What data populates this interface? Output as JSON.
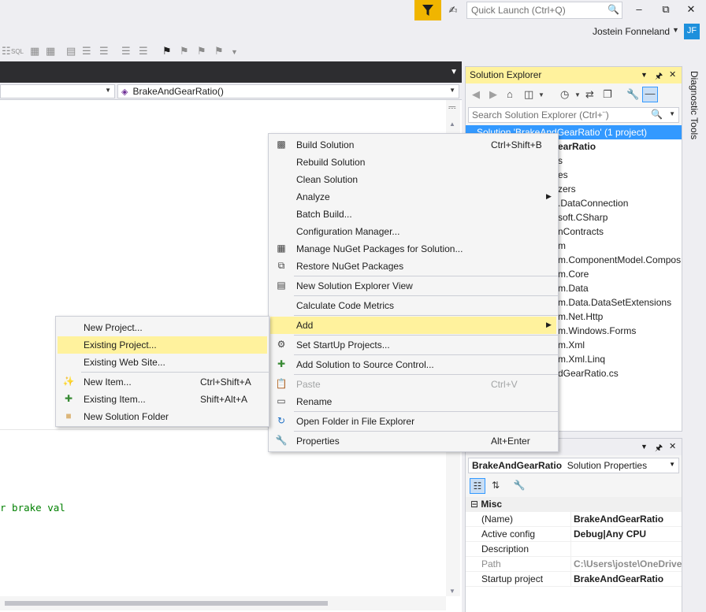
{
  "titlebar": {
    "quick_launch_placeholder": "Quick Launch (Ctrl+Q)",
    "user_name": "Jostein Fonneland",
    "user_initials": "JF",
    "filter_color": "#f0b500"
  },
  "editor": {
    "nav_member": "BrakeAndGearRatio()",
    "code_fragment": "r brake val"
  },
  "solution_explorer": {
    "title": "Solution Explorer",
    "search_placeholder": "Search Solution Explorer (Ctrl+¨)",
    "selected_item": "Solution 'BrakeAndGearRatio' (1 project)",
    "items": [
      "earRatio",
      "s",
      "es",
      "zers",
      ".DataConnection",
      "soft.CSharp",
      "nContracts",
      "m",
      "m.ComponentModel.Compos",
      "m.Core",
      "m.Data",
      "m.Data.DataSetExtensions",
      "m.Net.Http",
      "m.Windows.Forms",
      "m.Xml",
      "m.Xml.Linq",
      "dGearRatio.cs"
    ]
  },
  "diagnostic_tools": {
    "label": "Diagnostic Tools"
  },
  "properties": {
    "object_name": "BrakeAndGearRatio",
    "object_type": "Solution Properties",
    "category": "Misc",
    "rows": [
      {
        "name": "(Name)",
        "value": "BrakeAndGearRatio"
      },
      {
        "name": "Active config",
        "value": "Debug|Any CPU"
      },
      {
        "name": "Description",
        "value": ""
      },
      {
        "name": "Path",
        "value": "C:\\Users\\joste\\OneDrive"
      },
      {
        "name": "Startup project",
        "value": "BrakeAndGearRatio"
      }
    ]
  },
  "context_menu": {
    "items": [
      {
        "label": "Build Solution",
        "shortcut": "Ctrl+Shift+B",
        "icon": "build-icon"
      },
      {
        "label": "Rebuild Solution",
        "shortcut": "",
        "icon": ""
      },
      {
        "label": "Clean Solution",
        "shortcut": "",
        "icon": ""
      },
      {
        "label": "Analyze",
        "shortcut": "",
        "icon": ""
      },
      {
        "label": "Batch Build...",
        "shortcut": "",
        "icon": ""
      },
      {
        "label": "Configuration Manager...",
        "shortcut": "",
        "icon": ""
      },
      {
        "label": "Manage NuGet Packages for Solution...",
        "shortcut": "",
        "icon": "nuget-icon"
      },
      {
        "label": "Restore NuGet Packages",
        "shortcut": "",
        "icon": "restore-icon"
      },
      {
        "label": "New Solution Explorer View",
        "shortcut": "",
        "icon": "new-view-icon"
      },
      {
        "label": "Calculate Code Metrics",
        "shortcut": "",
        "icon": ""
      },
      {
        "label": "Add",
        "shortcut": "",
        "icon": ""
      },
      {
        "label": "Set StartUp Projects...",
        "shortcut": "",
        "icon": "gear-icon"
      },
      {
        "label": "Add Solution to Source Control...",
        "shortcut": "",
        "icon": "source-control-icon"
      },
      {
        "label": "Paste",
        "shortcut": "Ctrl+V",
        "icon": "paste-icon"
      },
      {
        "label": "Rename",
        "shortcut": "",
        "icon": "rename-icon"
      },
      {
        "label": "Open Folder in File Explorer",
        "shortcut": "",
        "icon": "open-folder-icon"
      },
      {
        "label": "Properties",
        "shortcut": "Alt+Enter",
        "icon": "wrench-icon"
      }
    ]
  },
  "add_submenu": {
    "items": [
      {
        "label": "New Project...",
        "shortcut": ""
      },
      {
        "label": "Existing Project...",
        "shortcut": ""
      },
      {
        "label": "Existing Web Site...",
        "shortcut": ""
      },
      {
        "label": "New Item...",
        "shortcut": "Ctrl+Shift+A"
      },
      {
        "label": "Existing Item...",
        "shortcut": "Shift+Alt+A"
      },
      {
        "label": "New Solution Folder",
        "shortcut": ""
      }
    ]
  }
}
